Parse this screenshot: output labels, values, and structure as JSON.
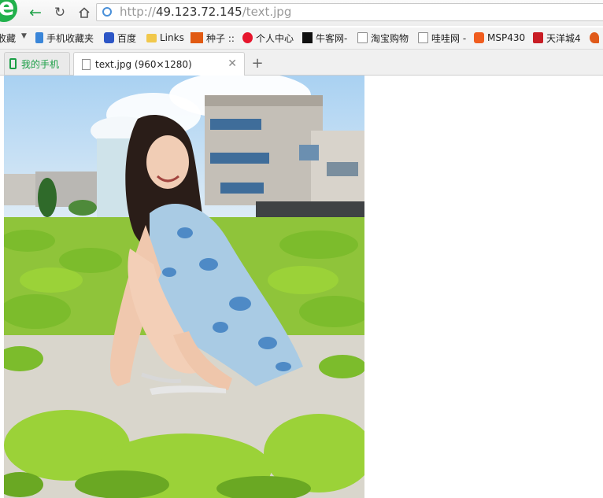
{
  "toolbar": {
    "back_icon": "arrow-left-icon",
    "reload_icon": "reload-icon",
    "home_icon": "home-icon"
  },
  "address_bar": {
    "scheme": "http://",
    "host": "49.123.72.145",
    "path": "/text.jpg"
  },
  "bookmarks": [
    {
      "label": "收藏",
      "icon": "star-icon"
    },
    {
      "label": "手机收藏夹",
      "icon": "phone-icon"
    },
    {
      "label": "百度",
      "icon": "paw-icon"
    },
    {
      "label": "Links",
      "icon": "folder-icon"
    },
    {
      "label": "种子 ::",
      "icon": "swd-icon"
    },
    {
      "label": "个人中心",
      "icon": "weibo-icon"
    },
    {
      "label": "牛客网-",
      "icon": "nowcoder-icon"
    },
    {
      "label": "淘宝购物",
      "icon": "page-icon"
    },
    {
      "label": "哇哇网 -",
      "icon": "page-icon"
    },
    {
      "label": "MSP430",
      "icon": "taobao-icon"
    },
    {
      "label": "天洋城4",
      "icon": "house-icon"
    }
  ],
  "tabs": [
    {
      "label": "我的手机",
      "active": false
    },
    {
      "label": "text.jpg (960×1280)",
      "active": true
    }
  ],
  "colors": {
    "accent": "#22b14c",
    "tab_phone": "#1a9e45"
  }
}
